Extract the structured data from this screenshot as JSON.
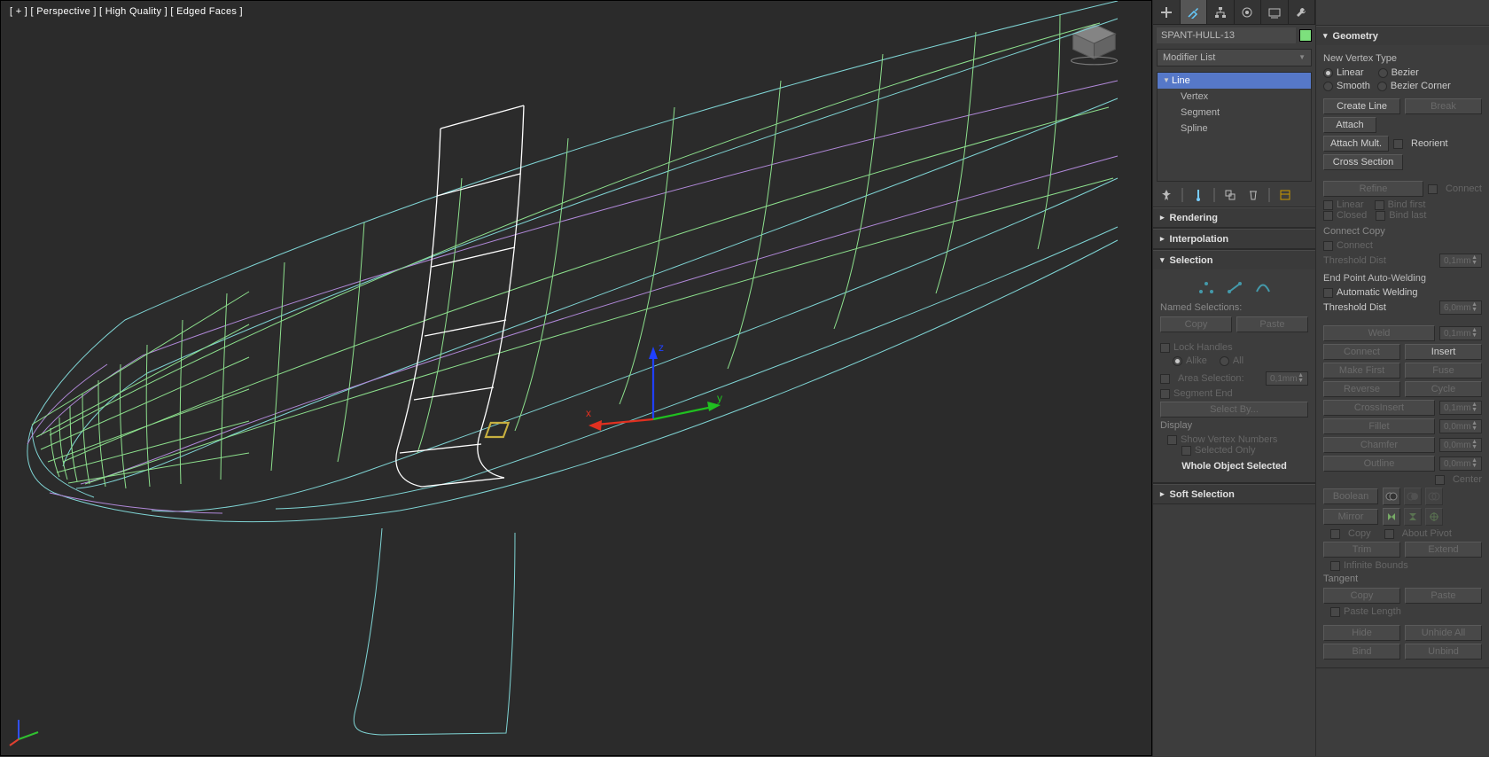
{
  "viewport": {
    "label": "[ + ] [ Perspective ] [ High Quality ] [ Edged Faces ]",
    "axes": {
      "x": "x",
      "y": "y",
      "z": "z"
    }
  },
  "objectName": "SPANT-HULL-13",
  "modifierList": "Modifier List",
  "modStack": {
    "root": "Line",
    "children": [
      "Vertex",
      "Segment",
      "Spline"
    ]
  },
  "rollouts": {
    "rendering": "Rendering",
    "interpolation": "Interpolation",
    "selection": "Selection",
    "softSelection": "Soft Selection",
    "geometry": "Geometry"
  },
  "selection": {
    "named": "Named Selections:",
    "copy": "Copy",
    "paste": "Paste",
    "lockHandles": "Lock Handles",
    "alike": "Alike",
    "all": "All",
    "areaSelection": "Area Selection:",
    "areaVal": "0,1mm",
    "segmentEnd": "Segment End",
    "selectBy": "Select By...",
    "display": "Display",
    "showVN": "Show Vertex Numbers",
    "selectedOnly": "Selected Only",
    "whole": "Whole Object Selected"
  },
  "geometry": {
    "newVertexType": "New Vertex Type",
    "linear": "Linear",
    "bezier": "Bezier",
    "smooth": "Smooth",
    "bezierCorner": "Bezier Corner",
    "createLine": "Create Line",
    "break": "Break",
    "attach": "Attach",
    "reorient": "Reorient",
    "attachMult": "Attach Mult.",
    "crossSection": "Cross Section",
    "refine": "Refine",
    "connect": "Connect",
    "linear2": "Linear",
    "bindFirst": "Bind first",
    "closed": "Closed",
    "bindLast": "Bind last",
    "connectCopy": "Connect Copy",
    "connect2": "Connect",
    "thresholdDist": "Threshold Dist",
    "tdVal1": "0,1mm",
    "endPointAW": "End Point Auto-Welding",
    "autoWeld": "Automatic Welding",
    "tdVal2": "6,0mm",
    "weld": "Weld",
    "weldVal": "0,1mm",
    "connect3": "Connect",
    "insert": "Insert",
    "makeFirst": "Make First",
    "fuse": "Fuse",
    "reverse": "Reverse",
    "cycle": "Cycle",
    "crossInsert": "CrossInsert",
    "ciVal": "0,1mm",
    "fillet": "Fillet",
    "filletVal": "0,0mm",
    "chamfer": "Chamfer",
    "chamferVal": "0,0mm",
    "outline": "Outline",
    "outlineVal": "0,0mm",
    "center": "Center",
    "boolean": "Boolean",
    "mirror": "Mirror",
    "copy2": "Copy",
    "aboutPivot": "About Pivot",
    "trim": "Trim",
    "extend": "Extend",
    "infBounds": "Infinite Bounds",
    "tangent": "Tangent",
    "tcopy": "Copy",
    "tpaste": "Paste",
    "pasteLength": "Paste Length",
    "hide": "Hide",
    "unhideAll": "Unhide All",
    "bind": "Bind",
    "unbind": "Unbind"
  }
}
